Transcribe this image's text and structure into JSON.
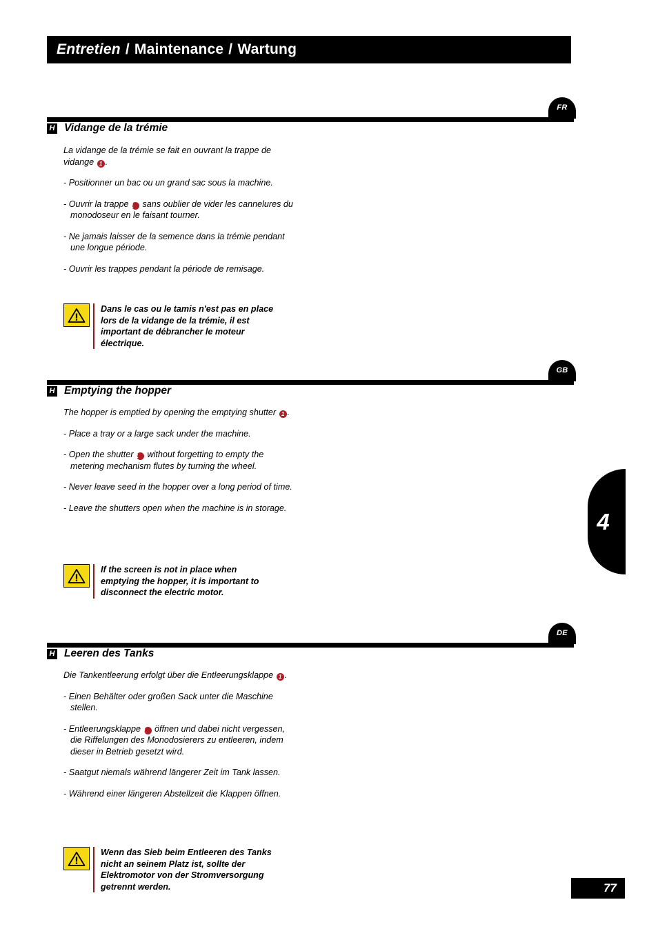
{
  "header": {
    "title_fr": "Entretien",
    "sep1": "/",
    "title_en": "Maintenance",
    "sep2": "/",
    "title_de": "Wartung"
  },
  "chapter": {
    "number": "4"
  },
  "page": {
    "number": "77"
  },
  "colors": {
    "bar": "#000000",
    "marker_red": "#AD1E26",
    "warning_yellow": "#F5D913",
    "warning_rule": "#8C1C1C"
  },
  "sections": [
    {
      "lang_badge": "FR",
      "letter": "H",
      "title": "Vidange de la trémie",
      "intro_a": "La vidange de la trémie se fait en ouvrant la trappe de vidange ",
      "intro_marker": "1",
      "intro_b": ".",
      "bullets": [
        {
          "text_a": "- Positionner un bac ou un grand sac sous la machine.",
          "marker": "",
          "text_b": ""
        },
        {
          "text_a": "- Ouvrir la trappe ",
          "marker": "1",
          "text_b": " sans oublier de vider les cannelures du monodoseur en le faisant tourner."
        },
        {
          "text_a": "- Ne jamais laisser de la semence dans la trémie pendant une longue période.",
          "marker": "",
          "text_b": ""
        },
        {
          "text_a": "- Ouvrir les trappes pendant la période de remisage.",
          "marker": "",
          "text_b": ""
        }
      ],
      "warning": "Dans le cas ou le tamis n'est pas en place lors de la vidange de la trémie, il est important de débrancher le moteur électrique.",
      "warning_icon": "warning-triangle-icon"
    },
    {
      "lang_badge": "GB",
      "letter": "H",
      "title": "Emptying the hopper",
      "intro_a": "The hopper is emptied by opening the emptying shutter ",
      "intro_marker": "1",
      "intro_b": ".",
      "bullets": [
        {
          "text_a": "- Place a tray or a large sack under the machine.",
          "marker": "",
          "text_b": ""
        },
        {
          "text_a": "- Open the shutter ",
          "marker": "1",
          "text_b": " without forgetting to empty the metering mechanism flutes by turning the wheel."
        },
        {
          "text_a": "- Never leave seed in the hopper over a long period of time.",
          "marker": "",
          "text_b": ""
        },
        {
          "text_a": "- Leave the shutters open when the machine is in storage.",
          "marker": "",
          "text_b": ""
        }
      ],
      "warning": "If the screen is not in place when emptying the hopper, it is important to disconnect the electric motor.",
      "warning_icon": "warning-triangle-icon"
    },
    {
      "lang_badge": "DE",
      "letter": "H",
      "title": "Leeren des Tanks",
      "intro_a": "Die Tankentleerung erfolgt über die Entleerungsklappe ",
      "intro_marker": "1",
      "intro_b": ".",
      "bullets": [
        {
          "text_a": "- Einen Behälter oder großen Sack unter die Maschine stellen.",
          "marker": "",
          "text_b": ""
        },
        {
          "text_a": "- Entleerungsklappe ",
          "marker": "1",
          "text_b": " öffnen und dabei nicht vergessen, die Riffelungen des Monodosierers zu entleeren, indem dieser in Betrieb gesetzt wird."
        },
        {
          "text_a": "- Saatgut niemals während längerer Zeit im Tank lassen.",
          "marker": "",
          "text_b": ""
        },
        {
          "text_a": "- Während einer längeren Abstellzeit die Klappen öffnen.",
          "marker": "",
          "text_b": ""
        }
      ],
      "warning": "Wenn das Sieb beim Entleeren des Tanks nicht an seinem Platz ist, sollte der Elektromotor von der Stromversorgung getrennt werden.",
      "warning_icon": "warning-triangle-icon"
    }
  ]
}
